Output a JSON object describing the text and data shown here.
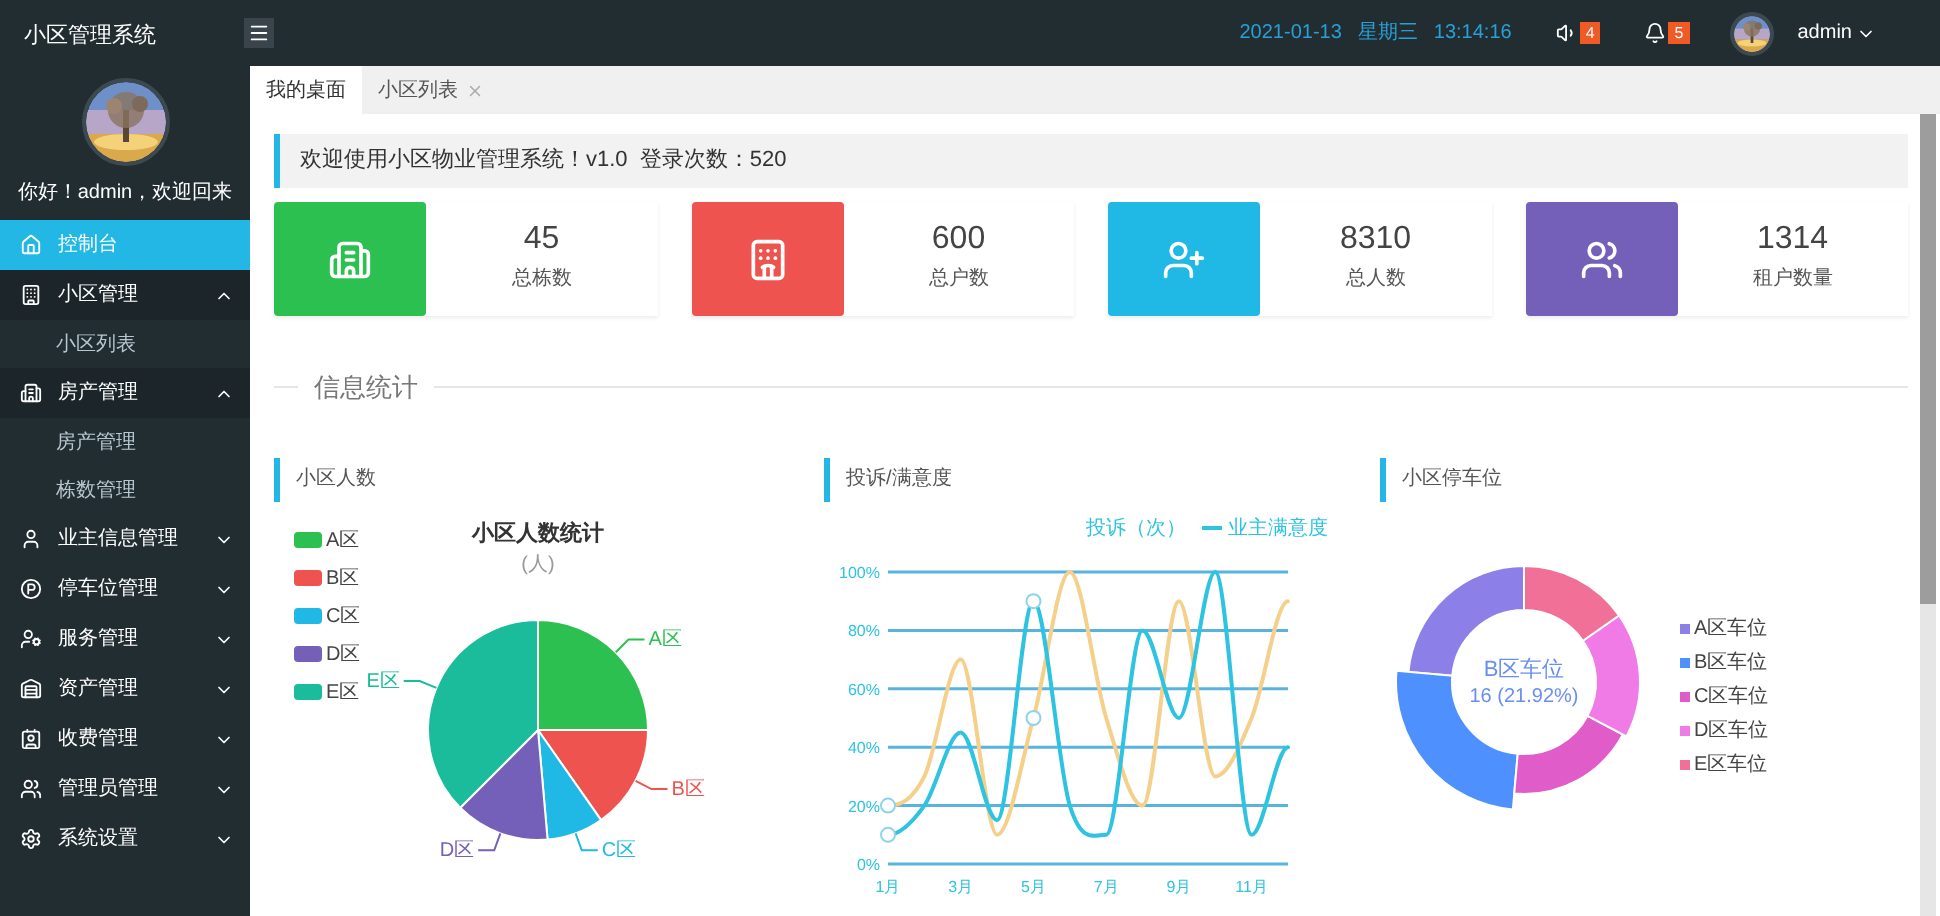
{
  "header": {
    "title": "小区管理系统",
    "date": "2021-01-13",
    "weekday": "星期三",
    "time": "13:14:16",
    "notice_count": "4",
    "alert_count": "5",
    "user": "admin"
  },
  "sidebar": {
    "greeting": "你好！admin，欢迎回来",
    "items": [
      {
        "kind": "link",
        "label": "控制台",
        "selected": true
      },
      {
        "kind": "group",
        "label": "小区管理",
        "selected": false,
        "expanded": true,
        "children": [
          {
            "label": "小区列表",
            "selected": false
          }
        ]
      },
      {
        "kind": "group",
        "label": "房产管理",
        "selected": false,
        "expanded": true,
        "children": [
          {
            "label": "房产管理",
            "selected": false
          },
          {
            "label": "栋数管理",
            "selected": false
          }
        ]
      },
      {
        "kind": "group",
        "label": "业主信息管理",
        "selected": false,
        "expanded": false
      },
      {
        "kind": "group",
        "label": "停车位管理",
        "selected": false,
        "expanded": false
      },
      {
        "kind": "group",
        "label": "服务管理",
        "selected": false,
        "expanded": false
      },
      {
        "kind": "group",
        "label": "资产管理",
        "selected": false,
        "expanded": false
      },
      {
        "kind": "group",
        "label": "收费管理",
        "selected": false,
        "expanded": false
      },
      {
        "kind": "group",
        "label": "管理员管理",
        "selected": false,
        "expanded": false
      },
      {
        "kind": "group",
        "label": "系统设置",
        "selected": false,
        "expanded": false
      }
    ]
  },
  "tabs": [
    {
      "label": "我的桌面",
      "selected": true,
      "closable": false
    },
    {
      "label": "小区列表",
      "selected": false,
      "closable": true
    }
  ],
  "welcome": "欢迎使用小区物业管理系统！v1.0  登录次数：520",
  "stats": [
    {
      "value": "45",
      "label": "总栋数",
      "color": "#2bc04f"
    },
    {
      "value": "600",
      "label": "总户数",
      "color": "#ef5350"
    },
    {
      "value": "8310",
      "label": "总人数",
      "color": "#20b8e4"
    },
    {
      "value": "1314",
      "label": "租户数量",
      "color": "#7460b8"
    }
  ],
  "section_title": "信息统计",
  "population": {
    "title": "小区人数",
    "chart_title": "小区人数统计",
    "unit": "(人)",
    "legend": [
      {
        "label": "A区",
        "color": "#2bc04f",
        "callout": "A区"
      },
      {
        "label": "B区",
        "color": "#ef5350",
        "callout": "B区"
      },
      {
        "label": "C区",
        "color": "#20b8e4",
        "callout": "C区"
      },
      {
        "label": "D区",
        "color": "#7460b8",
        "callout": "D区"
      },
      {
        "label": "E区",
        "color": "#1abc9c",
        "callout": "E区"
      }
    ]
  },
  "complaints": {
    "title": "投诉/满意度",
    "chart_data": {
      "type": "line",
      "grid": true,
      "xlim": [
        1,
        12
      ],
      "x": [
        1,
        2,
        3,
        4,
        5,
        6,
        7,
        8,
        9,
        10,
        11,
        12
      ],
      "xticks": [
        {
          "value": 1,
          "label": "1月"
        },
        {
          "value": 3,
          "label": "3月"
        },
        {
          "value": 5,
          "label": "5月"
        },
        {
          "value": 7,
          "label": "7月"
        },
        {
          "value": 9,
          "label": "9月"
        },
        {
          "value": 11,
          "label": "11月"
        }
      ],
      "ylim": [
        0,
        100
      ],
      "yticks": [
        {
          "value": 0,
          "label": "0%"
        },
        {
          "value": 20,
          "label": "20%"
        },
        {
          "value": 40,
          "label": "40%"
        },
        {
          "value": 60,
          "label": "60%"
        },
        {
          "value": 80,
          "label": "80%"
        },
        {
          "value": 100,
          "label": "100%"
        }
      ],
      "series": [
        {
          "name": "投诉（次）",
          "color": "#f5d08a",
          "values": [
            20,
            30,
            70,
            10,
            50,
            100,
            50,
            20,
            90,
            30,
            50,
            90
          ]
        },
        {
          "name": "业主满意度",
          "color": "#2ec3e0",
          "values": [
            10,
            20,
            45,
            15,
            90,
            20,
            10,
            80,
            50,
            100,
            10,
            40
          ]
        }
      ]
    }
  },
  "parking": {
    "title": "小区停车位",
    "center_label": "B区车位",
    "center_value": "16 (21.92%)",
    "legend": [
      {
        "label": "A区车位",
        "color": "#8c80e8"
      },
      {
        "label": "B区车位",
        "color": "#4f90ff"
      },
      {
        "label": "C区车位",
        "color": "#e05cc8"
      },
      {
        "label": "D区车位",
        "color": "#f07ae6"
      },
      {
        "label": "E区车位",
        "color": "#f07098"
      }
    ]
  }
}
